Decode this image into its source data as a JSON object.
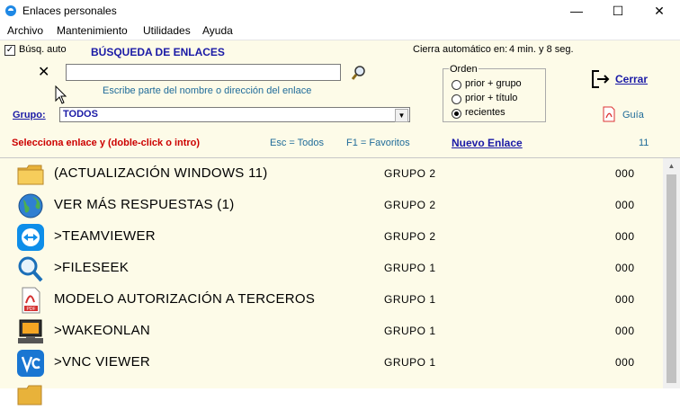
{
  "window": {
    "title": "Enlaces personales",
    "minimize": "—",
    "maximize": "☐",
    "close": "✕"
  },
  "menu": [
    "Archivo",
    "Mantenimiento",
    "Utilidades",
    "Ayuda"
  ],
  "search": {
    "auto_label": "Búsq. auto",
    "auto_checked": true,
    "heading": "BÚSQUEDA DE ENLACES",
    "clear_glyph": "✕",
    "value": "",
    "hint": "Escribe parte del nombre o dirección del enlace"
  },
  "autoclose": {
    "label": "Cierra automático en:",
    "value": "4 min.  y  8 seg."
  },
  "group": {
    "label": "Grupo:",
    "value": "TODOS"
  },
  "order": {
    "title": "Orden",
    "options": [
      "prior + grupo",
      "prior + título",
      "recientes"
    ],
    "selected": "recientes"
  },
  "actions": {
    "close": "Cerrar",
    "guide": "Guía"
  },
  "status": {
    "instruction": "Selecciona enlace y (doble-click o intro)",
    "esc": "Esc = Todos",
    "f1": "F1 = Favoritos",
    "new_link": "Nuevo Enlace",
    "count": "11"
  },
  "links": [
    {
      "name": "(ACTUALIZACIÓN WINDOWS 11)",
      "group": "GRUPO 2",
      "count": "000",
      "icon": "folder-icon"
    },
    {
      "name": "VER MÁS RESPUESTAS (1)",
      "group": "GRUPO 2",
      "count": "000",
      "icon": "globe-icon"
    },
    {
      "name": ">TEAMVIEWER",
      "group": "GRUPO 2",
      "count": "000",
      "icon": "teamviewer-icon"
    },
    {
      "name": ">FILESEEK",
      "group": "GRUPO 1",
      "count": "000",
      "icon": "magnifier-icon"
    },
    {
      "name": "MODELO AUTORIZACIÓN A TERCEROS",
      "group": "GRUPO 1",
      "count": "000",
      "icon": "pdf-icon"
    },
    {
      "name": ">WAKEONLAN",
      "group": "GRUPO 1",
      "count": "000",
      "icon": "computer-icon"
    },
    {
      "name": ">VNC VIEWER",
      "group": "GRUPO 1",
      "count": "000",
      "icon": "vnc-icon"
    }
  ],
  "colors": {
    "panel_bg": "#fdfbe8",
    "accent_blue": "#1a1aa6",
    "alert_red": "#cc0000"
  }
}
